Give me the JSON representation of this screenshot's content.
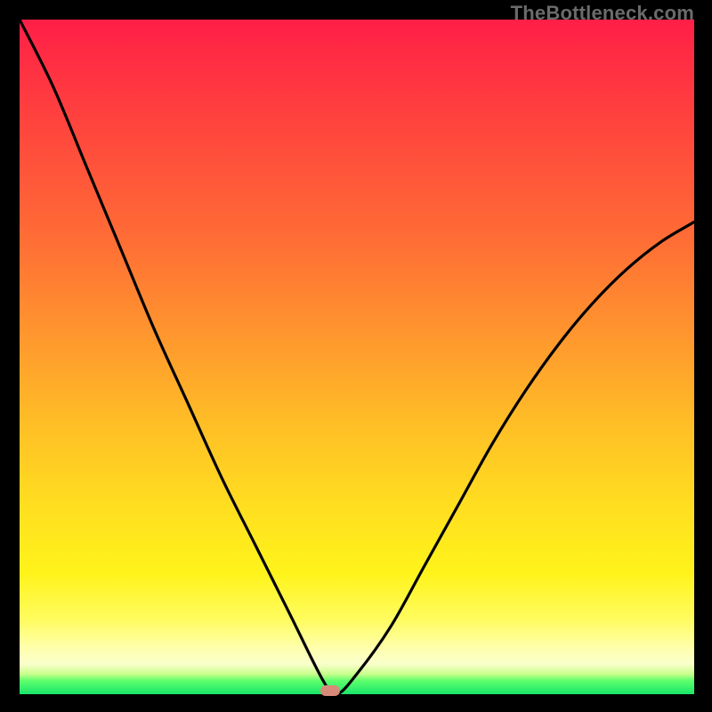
{
  "watermark": "TheBottleneck.com",
  "colors": {
    "page_bg": "#000000",
    "curve": "#000000",
    "bump": "#d88a7a",
    "watermark_text": "#6b6b6b"
  },
  "chart_data": {
    "type": "line",
    "title": "",
    "xlabel": "",
    "ylabel": "",
    "xlim": [
      0,
      100
    ],
    "ylim": [
      0,
      100
    ],
    "grid": false,
    "note": "V-shaped bottleneck curve; y≈0 at x≈45-47; rises steeply on both sides. Background is a vertical red→yellow→green gradient indicating goodness (green at bottom).",
    "x": [
      0,
      5,
      10,
      15,
      20,
      25,
      30,
      35,
      40,
      45,
      47,
      50,
      55,
      60,
      65,
      70,
      75,
      80,
      85,
      90,
      95,
      100
    ],
    "values": [
      100,
      90,
      78,
      66,
      54,
      43,
      32,
      22,
      12,
      2,
      0,
      3,
      10,
      19,
      28,
      37,
      45,
      52,
      58,
      63,
      67,
      70
    ],
    "minimum_marker": {
      "x": 46,
      "y": 0
    }
  }
}
